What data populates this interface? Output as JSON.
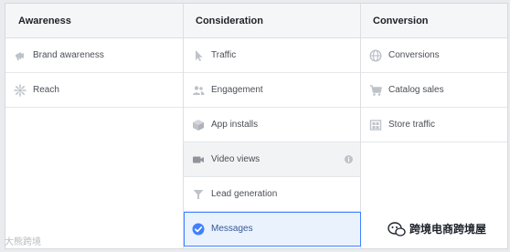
{
  "columns": [
    {
      "title": "Awareness",
      "items": [
        {
          "label": "Brand awareness",
          "icon": "megaphone-icon"
        },
        {
          "label": "Reach",
          "icon": "reach-burst-icon"
        }
      ]
    },
    {
      "title": "Consideration",
      "items": [
        {
          "label": "Traffic",
          "icon": "cursor-icon"
        },
        {
          "label": "Engagement",
          "icon": "people-icon"
        },
        {
          "label": "App installs",
          "icon": "box-icon"
        },
        {
          "label": "Video views",
          "icon": "video-camera-icon"
        },
        {
          "label": "Lead generation",
          "icon": "funnel-icon"
        },
        {
          "label": "Messages",
          "icon": "check-circle-icon"
        }
      ]
    },
    {
      "title": "Conversion",
      "items": [
        {
          "label": "Conversions",
          "icon": "globe-icon"
        },
        {
          "label": "Catalog sales",
          "icon": "cart-icon"
        },
        {
          "label": "Store traffic",
          "icon": "store-icon"
        }
      ]
    }
  ],
  "state": {
    "hovered": "Video views",
    "selected": "Messages"
  },
  "colors": {
    "icon_gray": "#bec3c9",
    "selected_blue": "#4080ff",
    "selected_bg": "#eaf2fd"
  },
  "watermarks": {
    "left": "大熊跨境",
    "right": "跨境电商跨境屋"
  }
}
